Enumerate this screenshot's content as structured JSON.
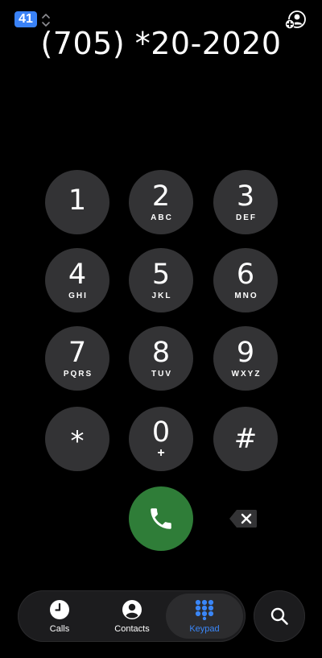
{
  "header": {
    "sim_badge": "41",
    "icons": {
      "sim_chevron": "chevron-up-down-icon",
      "add_contact": "add-contact-icon"
    }
  },
  "display": {
    "number": "(705) *20-2020"
  },
  "keypad": {
    "keys": [
      {
        "digit": "1",
        "letters": ""
      },
      {
        "digit": "2",
        "letters": "ABC"
      },
      {
        "digit": "3",
        "letters": "DEF"
      },
      {
        "digit": "4",
        "letters": "GHI"
      },
      {
        "digit": "5",
        "letters": "JKL"
      },
      {
        "digit": "6",
        "letters": "MNO"
      },
      {
        "digit": "7",
        "letters": "PQRS"
      },
      {
        "digit": "8",
        "letters": "TUV"
      },
      {
        "digit": "9",
        "letters": "WXYZ"
      },
      {
        "digit": "*",
        "letters": ""
      },
      {
        "digit": "0",
        "letters": "+"
      },
      {
        "digit": "#",
        "letters": ""
      }
    ],
    "call_icon": "phone-icon",
    "delete_icon": "delete-backspace-icon"
  },
  "tabs": {
    "items": [
      {
        "label": "Calls",
        "icon": "clock-icon",
        "active": false
      },
      {
        "label": "Contacts",
        "icon": "person-circle-icon",
        "active": false
      },
      {
        "label": "Keypad",
        "icon": "keypad-grid-icon",
        "active": true
      }
    ],
    "search_icon": "search-icon"
  },
  "colors": {
    "background": "#000000",
    "key_fill": "#333335",
    "call_green": "#2f7d38",
    "accent_blue": "#3a86f7",
    "tab_bar": "#1c1c1e"
  }
}
